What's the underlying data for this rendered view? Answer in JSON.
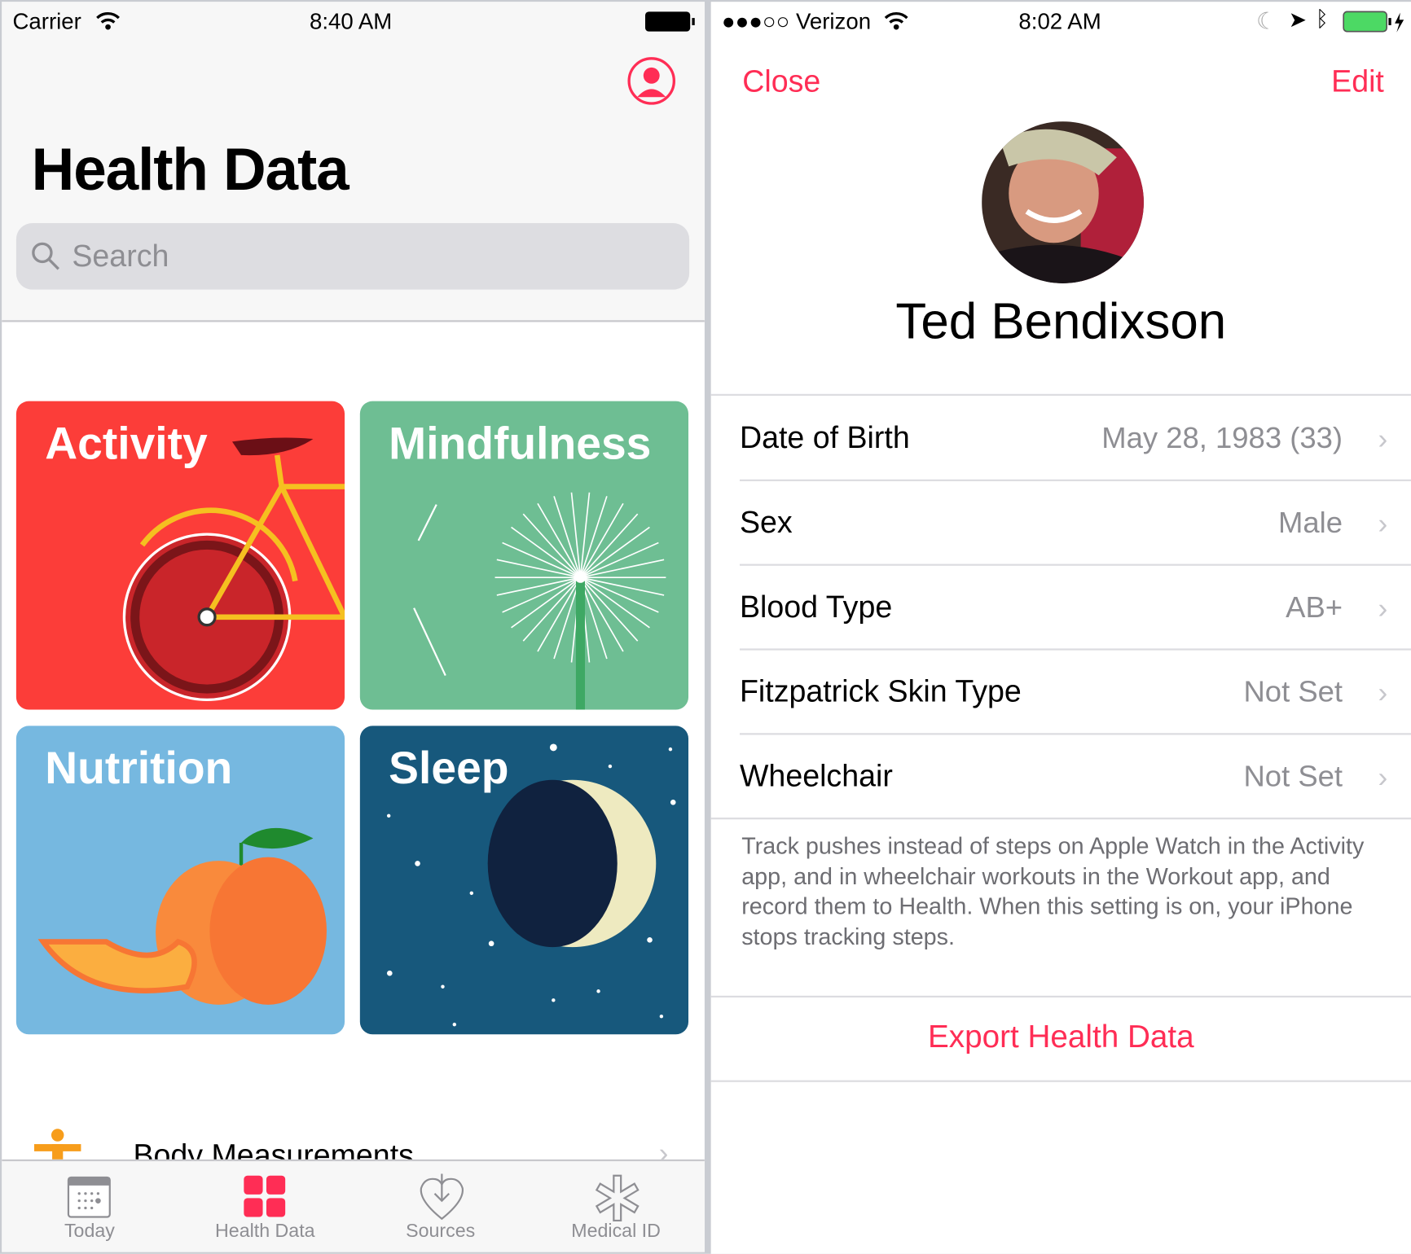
{
  "left": {
    "status": {
      "carrier": "Carrier",
      "time": "8:40 AM"
    },
    "title": "Health Data",
    "search": {
      "placeholder": "Search"
    },
    "tiles": [
      {
        "label": "Activity",
        "color": "#fc3d39"
      },
      {
        "label": "Mindfulness",
        "color": "#6ebe93"
      },
      {
        "label": "Nutrition",
        "color": "#76b8e0"
      },
      {
        "label": "Sleep",
        "color": "#17587c"
      }
    ],
    "list": [
      {
        "label": "Body Measurements",
        "icon": "body-figure-icon"
      }
    ],
    "tabs": [
      {
        "label": "Today",
        "icon": "calendar-icon"
      },
      {
        "label": "Health Data",
        "icon": "grid-icon",
        "active": true
      },
      {
        "label": "Sources",
        "icon": "heart-download-icon"
      },
      {
        "label": "Medical ID",
        "icon": "asterisk-icon"
      }
    ],
    "accent": "#ff2d55"
  },
  "right": {
    "status": {
      "carrier": "●●●○○ Verizon",
      "time": "8:02 AM"
    },
    "nav": {
      "close": "Close",
      "edit": "Edit"
    },
    "name": "Ted Bendixson",
    "rows": [
      {
        "label": "Date of Birth",
        "value": "May 28, 1983 (33)"
      },
      {
        "label": "Sex",
        "value": "Male"
      },
      {
        "label": "Blood Type",
        "value": "AB+"
      },
      {
        "label": "Fitzpatrick Skin Type",
        "value": "Not Set"
      },
      {
        "label": "Wheelchair",
        "value": "Not Set"
      }
    ],
    "footnote": "Track pushes instead of steps on Apple Watch in the Activity app, and in wheelchair workouts in the Workout app, and record them to Health. When this setting is on, your iPhone stops tracking steps.",
    "export": "Export Health Data",
    "battery_color": "#4cd964"
  }
}
